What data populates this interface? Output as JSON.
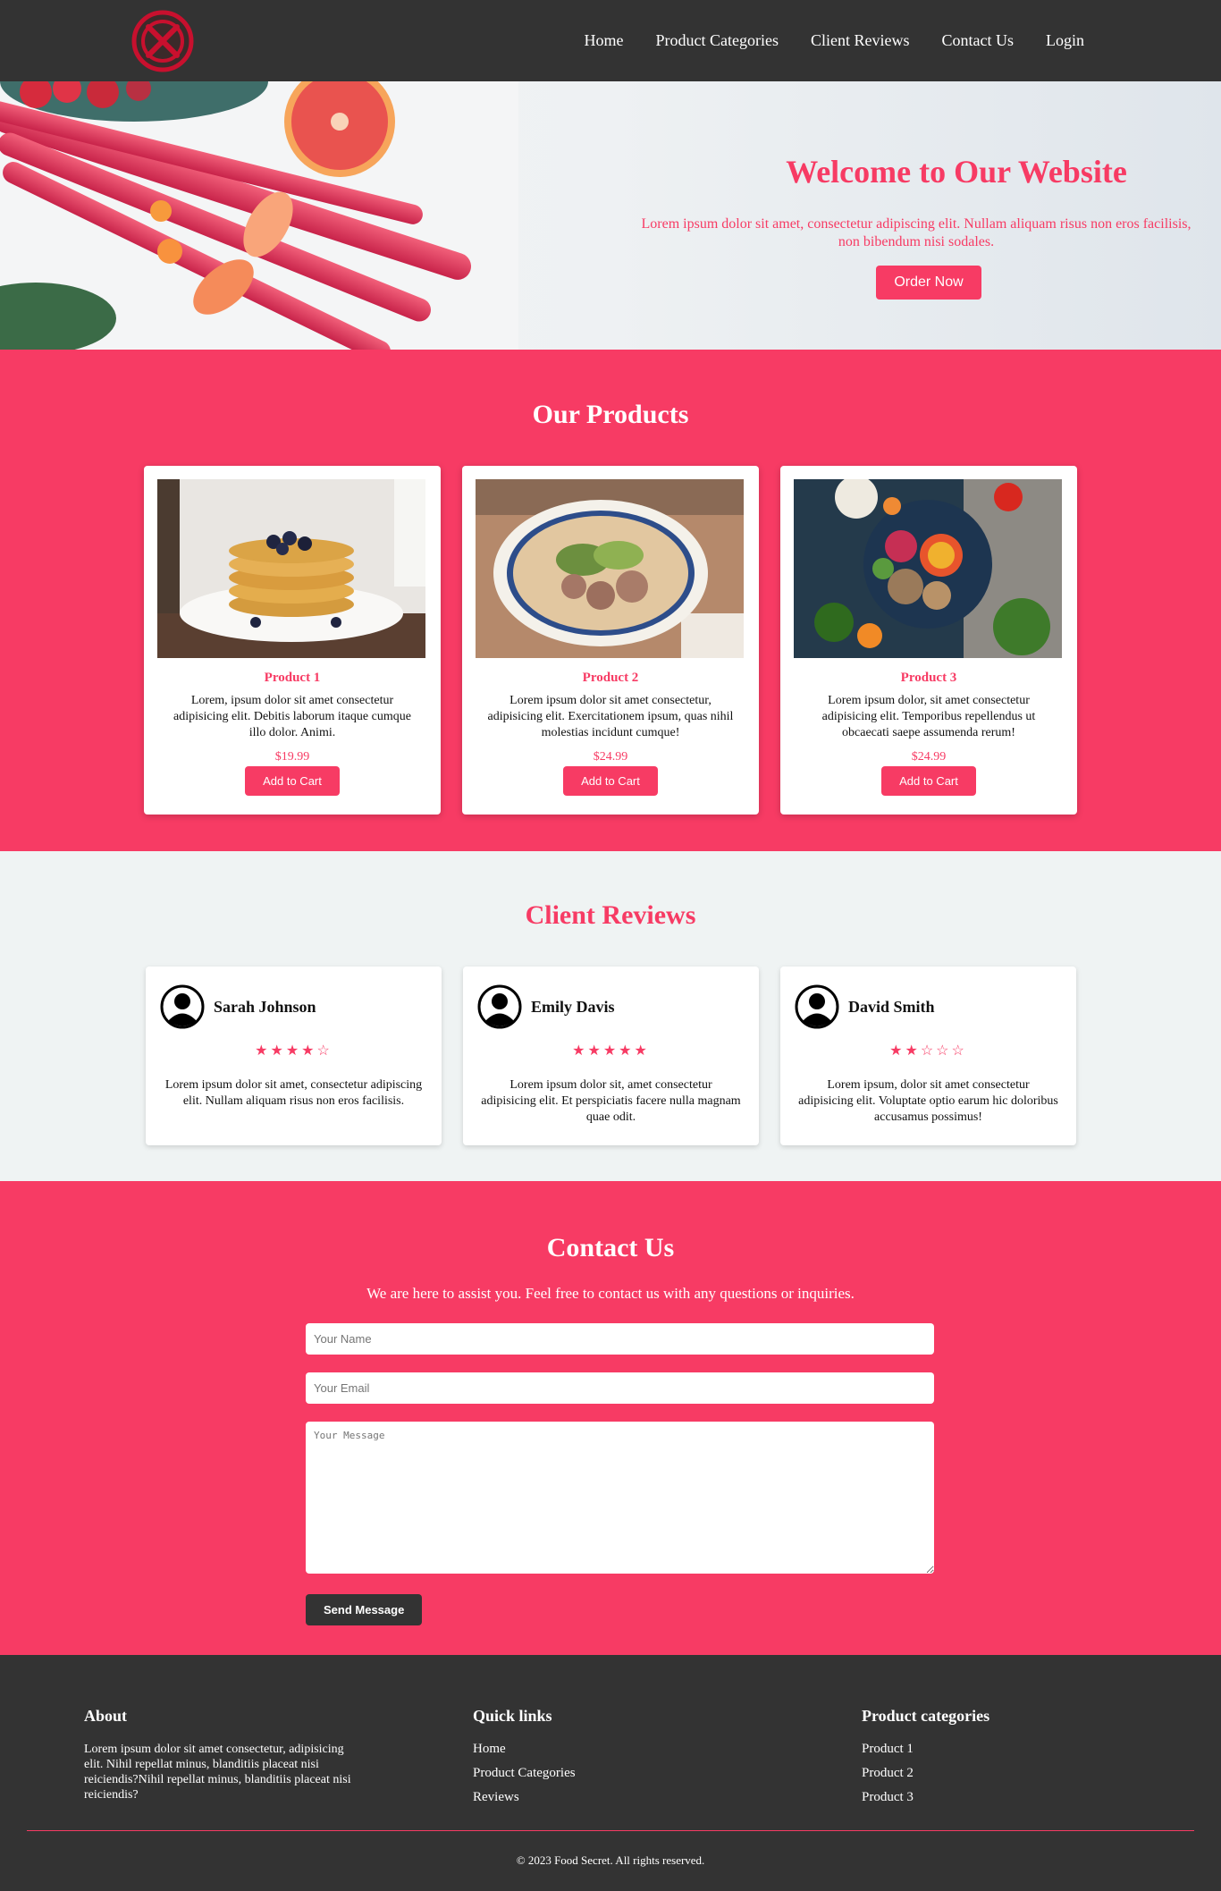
{
  "nav": {
    "items": [
      "Home",
      "Product Categories",
      "Client Reviews",
      "Contact Us",
      "Login"
    ]
  },
  "hero": {
    "title": "Welcome to Our Website",
    "subtitle": "Lorem ipsum dolor sit amet, consectetur adipiscing elit. Nullam aliquam risus non eros facilisis, non bibendum nisi sodales.",
    "cta": "Order Now"
  },
  "products": {
    "title": "Our Products",
    "items": [
      {
        "name": "Product 1",
        "desc": "Lorem, ipsum dolor sit amet consectetur adipisicing elit. Debitis laborum itaque cumque illo dolor. Animi.",
        "price": "$19.99",
        "button": "Add to Cart"
      },
      {
        "name": "Product 2",
        "desc": "Lorem ipsum dolor sit amet consectetur, adipisicing elit. Exercitationem ipsum, quas nihil molestias incidunt cumque!",
        "price": "$24.99",
        "button": "Add to Cart"
      },
      {
        "name": "Product 3",
        "desc": "Lorem ipsum dolor, sit amet consectetur adipisicing elit. Temporibus repellendus ut obcaecati saepe assumenda rerum!",
        "price": "$24.99",
        "button": "Add to Cart"
      }
    ]
  },
  "reviews": {
    "title": "Client Reviews",
    "items": [
      {
        "name": "Sarah Johnson",
        "rating": 4,
        "stars": "★★★★☆",
        "text": "Lorem ipsum dolor sit amet, consectetur adipiscing elit. Nullam aliquam risus non eros facilisis."
      },
      {
        "name": "Emily Davis",
        "rating": 5,
        "stars": "★★★★★",
        "text": "Lorem ipsum dolor sit, amet consectetur adipisicing elit. Et perspiciatis facere nulla magnam quae odit."
      },
      {
        "name": "David Smith",
        "rating": 2,
        "stars": "★★☆☆☆",
        "text": "Lorem ipsum, dolor sit amet consectetur adipisicing elit. Voluptate optio earum hic doloribus accusamus possimus!"
      }
    ]
  },
  "contact": {
    "title": "Contact Us",
    "subtitle": "We are here to assist you. Feel free to contact us with any questions or inquiries.",
    "name_placeholder": "Your Name",
    "email_placeholder": "Your Email",
    "message_placeholder": "Your Message",
    "submit": "Send Message"
  },
  "footer": {
    "about_title": "About",
    "about_text": "Lorem ipsum dolor sit amet consectetur, adipisicing elit. Nihil repellat minus, blanditiis placeat nisi reiciendis?Nihil repellat minus, blanditiis placeat nisi reiciendis?",
    "links_title": "Quick links",
    "links": [
      "Home",
      "Product Categories",
      "Reviews"
    ],
    "cats_title": "Product categories",
    "cats": [
      "Product 1",
      "Product 2",
      "Product 3"
    ],
    "copyright": "© 2023 Food Secret. All rights reserved."
  },
  "colors": {
    "accent": "#f73b64",
    "dark": "#333333",
    "light_bg": "#eff3f3"
  }
}
